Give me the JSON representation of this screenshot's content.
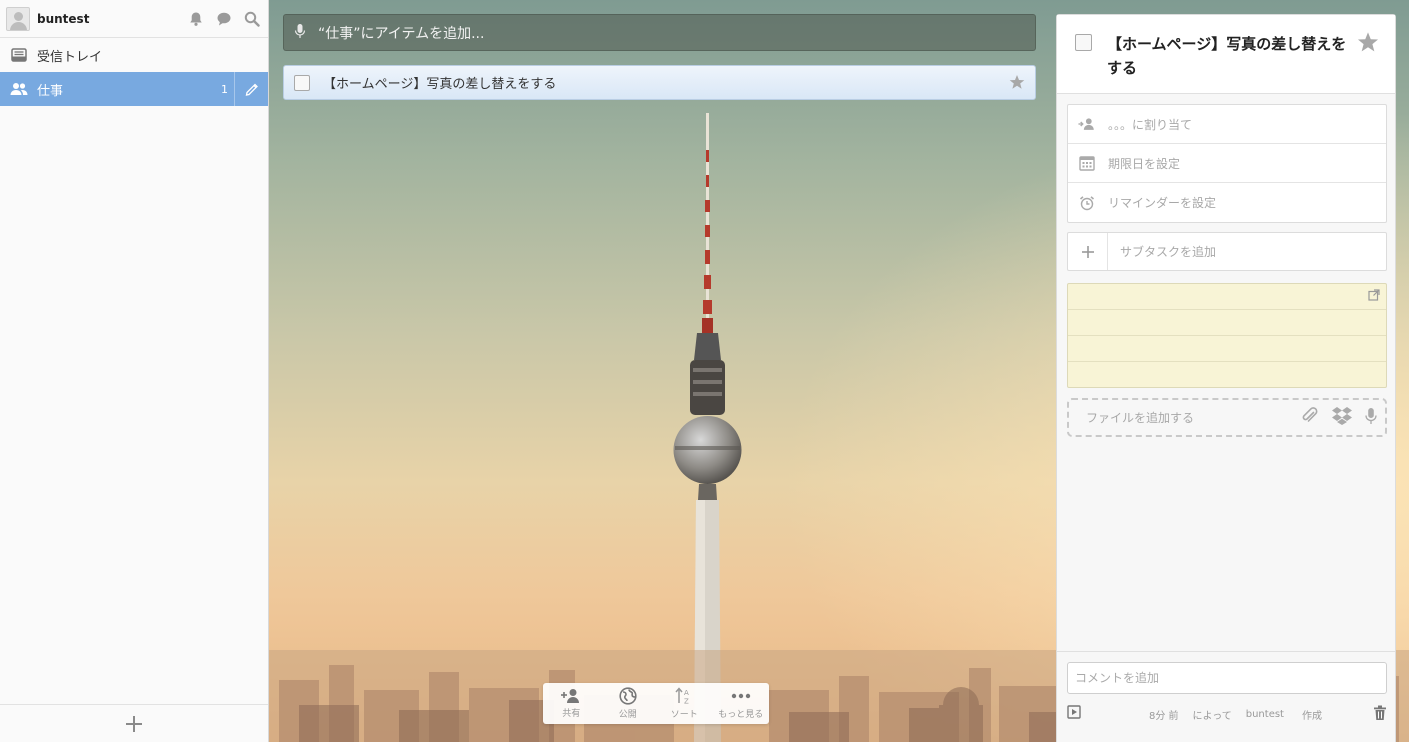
{
  "user": {
    "name": "buntest"
  },
  "header_icons": [
    "bell-icon",
    "speech-bubble-icon",
    "search-icon"
  ],
  "sidebar": {
    "items": [
      {
        "label": "受信トレイ",
        "icon": "inbox-icon",
        "count": ""
      },
      {
        "label": "仕事",
        "icon": "shared-list-icon",
        "count": "1",
        "active": true
      }
    ],
    "footer_icon": "plus-icon"
  },
  "main": {
    "add_placeholder": "“仕事”にアイテムを追加...",
    "tasks": [
      {
        "title": "【ホームページ】写真の差し替えをする",
        "starred": false
      }
    ],
    "toolbar": [
      {
        "label": "共有",
        "icon": "add-person-icon"
      },
      {
        "label": "公開",
        "icon": "globe-icon"
      },
      {
        "label": "ソート",
        "icon": "sort-icon"
      },
      {
        "label": "もっと見る",
        "icon": "more-dots-icon"
      }
    ]
  },
  "detail": {
    "title": "【ホームページ】写真の差し替えをする",
    "assign_label": "。。。に割り当て",
    "due_label": "期限日を設定",
    "reminder_label": "リマインダーを設定",
    "subtask_placeholder": "サブタスクを追加",
    "files_label": "ファイルを追加する",
    "comment_placeholder": "コメントを追加",
    "meta": {
      "ago": "8分 前",
      "by": "によって",
      "user": "buntest",
      "created": "作成"
    }
  },
  "colors": {
    "active_item": "#78a9e0",
    "task_bg": "#e3edf8",
    "note_bg": "#f8f4d6"
  }
}
